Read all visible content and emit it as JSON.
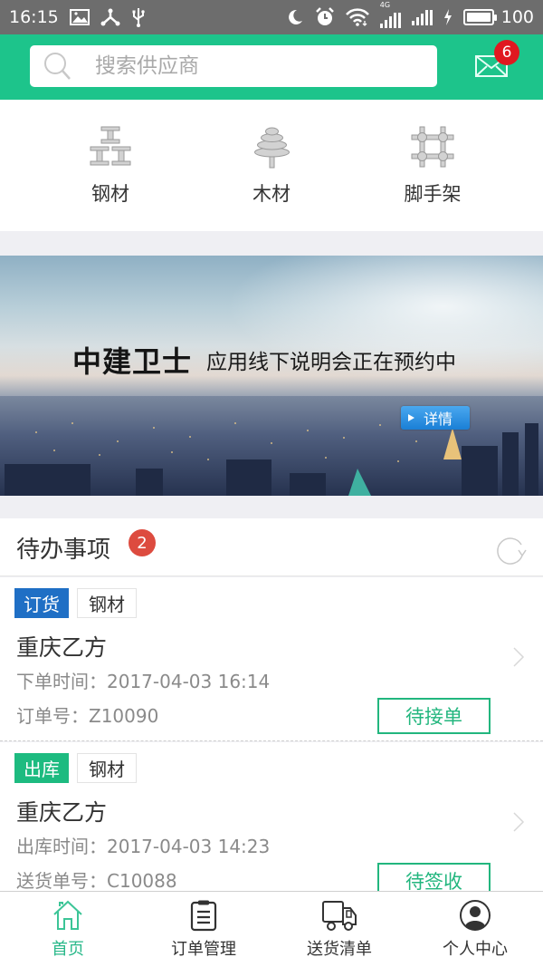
{
  "status_bar": {
    "time": "16:15",
    "network_type": "4G",
    "battery_percent": "100",
    "left_icons": [
      "image-icon",
      "share-icon",
      "usb-icon"
    ],
    "right_icons": [
      "night-mode-icon",
      "alarm-icon",
      "wifi-icon",
      "signal-4g-icon",
      "signal-icon",
      "charging-icon",
      "battery-icon"
    ]
  },
  "header": {
    "search_placeholder": "搜索供应商",
    "search_value": "",
    "message_count": "6",
    "colors": {
      "primary": "#1dc48b",
      "badge": "#e01820"
    }
  },
  "categories": [
    {
      "label": "钢材",
      "icon": "steel-beam-icon"
    },
    {
      "label": "木材",
      "icon": "tree-icon"
    },
    {
      "label": "脚手架",
      "icon": "scaffold-icon"
    }
  ],
  "banner": {
    "title": "中建卫士",
    "subtitle": "应用线下说明会正在预约中",
    "detail_button": "详情"
  },
  "todo": {
    "title": "待办事项",
    "count": "2",
    "items": [
      {
        "type_tag": "订货",
        "type_color": "#1f6fc5",
        "material_tag": "钢材",
        "company": "重庆乙方",
        "time_label": "下单时间：",
        "time_value": "2017-04-03 16:14",
        "number_label": "订单号：",
        "number_value": "Z10090",
        "status": "待接单"
      },
      {
        "type_tag": "出库",
        "type_color": "#1dbb80",
        "material_tag": "钢材",
        "company": "重庆乙方",
        "time_label": "出库时间：",
        "time_value": "2017-04-03 14:23",
        "number_label": "送货单号：",
        "number_value": "C10088",
        "status": "待签收"
      }
    ]
  },
  "bottom_nav": {
    "active": "首页",
    "items": [
      {
        "label": "首页",
        "icon": "home-icon"
      },
      {
        "label": "订单管理",
        "icon": "clipboard-icon"
      },
      {
        "label": "送货清单",
        "icon": "truck-icon"
      },
      {
        "label": "个人中心",
        "icon": "user-icon"
      }
    ]
  }
}
